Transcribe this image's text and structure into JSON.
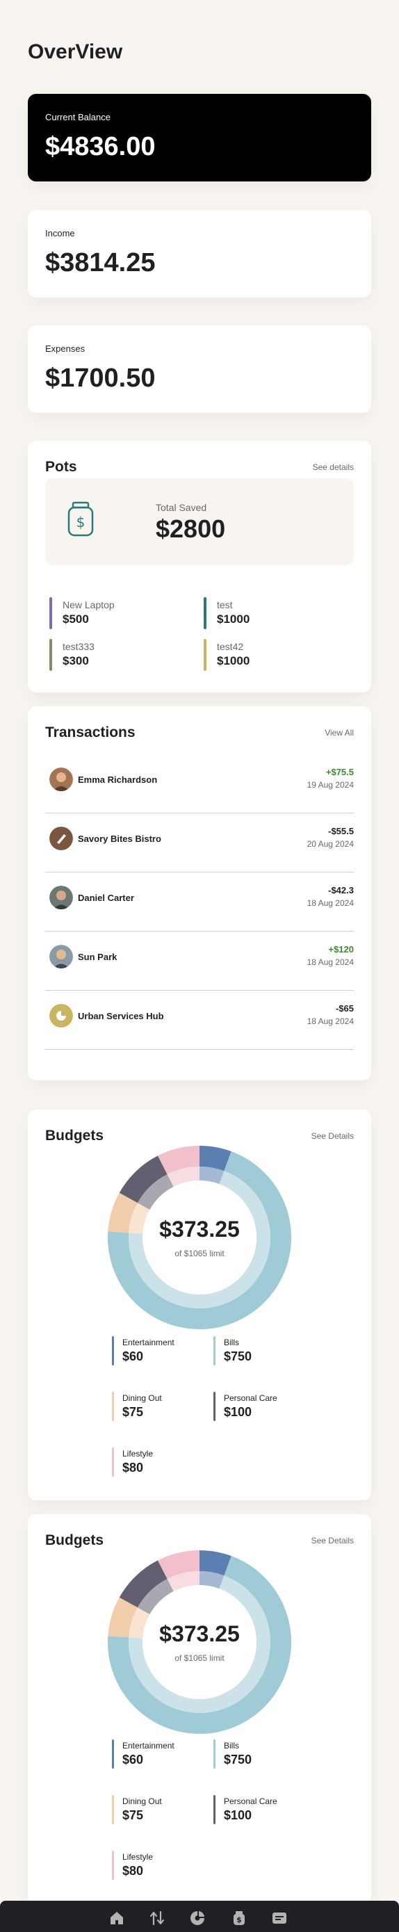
{
  "page": {
    "title": "OverView"
  },
  "summary": {
    "current_balance": {
      "label": "Current Balance",
      "amount": "$4836.00"
    },
    "income": {
      "label": "Income",
      "amount": "$3814.25"
    },
    "expenses": {
      "label": "Expenses",
      "amount": "$1700.50"
    }
  },
  "pots": {
    "title": "Pots",
    "link": "See details",
    "total_saved_label": "Total Saved",
    "total_saved_amount": "$2800",
    "items": [
      {
        "name": "New Laptop",
        "value": "$500",
        "color": "#826cb0"
      },
      {
        "name": "test",
        "value": "$1000",
        "color": "#277c78"
      },
      {
        "name": "test333",
        "value": "$300",
        "color": "#7f9161"
      },
      {
        "name": "test42",
        "value": "$1000",
        "color": "#cab361"
      }
    ]
  },
  "transactions": {
    "title": "Transactions",
    "link": "View All",
    "items": [
      {
        "name": "Emma Richardson",
        "amount": "+$75.5",
        "date": "19 Aug 2024",
        "positive": true
      },
      {
        "name": "Savory Bites Bistro",
        "amount": "-$55.5",
        "date": "20 Aug 2024",
        "positive": false
      },
      {
        "name": "Daniel Carter",
        "amount": "-$42.3",
        "date": "18 Aug 2024",
        "positive": false
      },
      {
        "name": "Sun Park",
        "amount": "+$120",
        "date": "18 Aug 2024",
        "positive": true
      },
      {
        "name": "Urban Services Hub",
        "amount": "-$65",
        "date": "18 Aug 2024",
        "positive": false
      }
    ]
  },
  "budgets": [
    {
      "title": "Budgets",
      "link": "See Details",
      "center_amount": "$373.25",
      "center_limit": "of $1065 limit",
      "legend": [
        {
          "name": "Entertainment",
          "value": "$60",
          "color": "#5b7fb0"
        },
        {
          "name": "Bills",
          "value": "$750",
          "color": "#9ecbd6"
        },
        {
          "name": "Dining Out",
          "value": "$75",
          "color": "#f2cdac"
        },
        {
          "name": "Personal Care",
          "value": "$100",
          "color": "#626070"
        },
        {
          "name": "Lifestyle",
          "value": "$80",
          "color": "#f1c0ca"
        }
      ]
    },
    {
      "title": "Budgets",
      "link": "See Details",
      "center_amount": "$373.25",
      "center_limit": "of $1065 limit",
      "legend": [
        {
          "name": "Entertainment",
          "value": "$60",
          "color": "#5b7fb0"
        },
        {
          "name": "Bills",
          "value": "$750",
          "color": "#9ecbd6"
        },
        {
          "name": "Dining Out",
          "value": "$75",
          "color": "#f2cdac"
        },
        {
          "name": "Personal Care",
          "value": "$100",
          "color": "#626070"
        },
        {
          "name": "Lifestyle",
          "value": "$80",
          "color": "#f1c0ca"
        }
      ]
    }
  ],
  "nav": {
    "items": [
      {
        "icon": "home-icon"
      },
      {
        "icon": "transactions-icon"
      },
      {
        "icon": "budgets-icon"
      },
      {
        "icon": "pots-icon"
      },
      {
        "icon": "recurring-bills-icon"
      }
    ]
  }
}
